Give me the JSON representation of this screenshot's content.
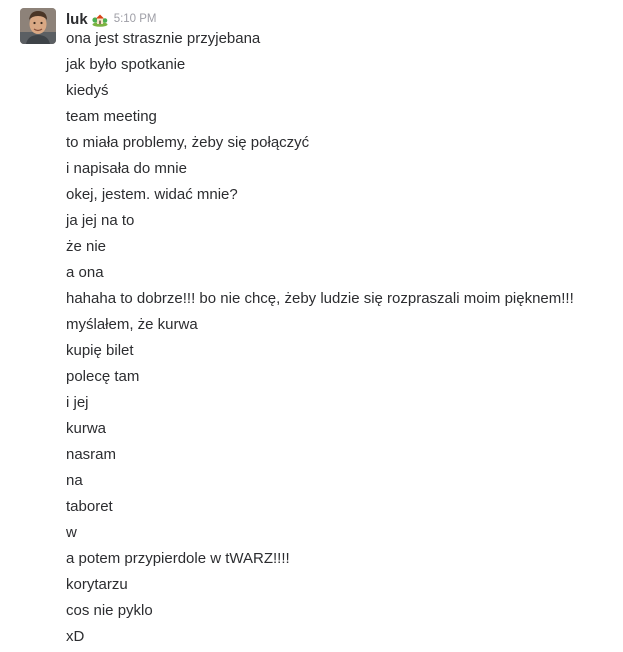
{
  "message": {
    "author": "luk",
    "status_emoji": "house-with-garden-icon",
    "timestamp": "5:10 PM",
    "lines": [
      "ona jest strasznie przyjebana",
      "jak było spotkanie",
      "kiedyś",
      "team meeting",
      "to miała problemy, żeby się połączyć",
      "i napisała do mnie",
      "okej, jestem. widać mnie?",
      "ja jej na to",
      "że nie",
      "a ona",
      "hahaha to dobrze!!! bo nie chcę, żeby ludzie się rozpraszali moim pięknem!!!",
      "myślałem, że kurwa",
      "kupię bilet",
      "polecę tam",
      "i jej",
      "kurwa",
      "nasram",
      "na",
      "taboret",
      "w",
      "a potem przypierdole w tWARZ!!!!",
      "korytarzu",
      "cos nie pyklo",
      "xD"
    ]
  },
  "colors": {
    "text": "#2c2d30",
    "timestamp": "#9e9ea6",
    "background": "#ffffff"
  }
}
